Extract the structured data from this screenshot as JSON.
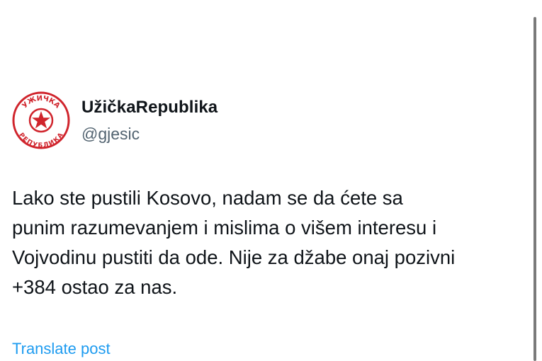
{
  "author": {
    "display_name": "UžičkaRepublika",
    "handle": "@gjesic",
    "avatar": {
      "icon": "red-star-stamp-logo-icon",
      "text_top": "УЖИЧКА",
      "text_bottom": "РЕПУБЛИКА",
      "color": "#d0242c"
    }
  },
  "post": {
    "lines": [
      "Lako ste pustili Kosovo, nadam se da ćete sa",
      "punim razumevanjem i mislima o višem interesu i",
      "Vojvodinu pustiti da ode. Nije za džabe onaj pozivni",
      "+384 ostao za nas."
    ]
  },
  "translate_label": "Translate post",
  "colors": {
    "text": "#0f1419",
    "secondary": "#536471",
    "link": "#1d9bf0",
    "logo_red": "#d0242c"
  }
}
